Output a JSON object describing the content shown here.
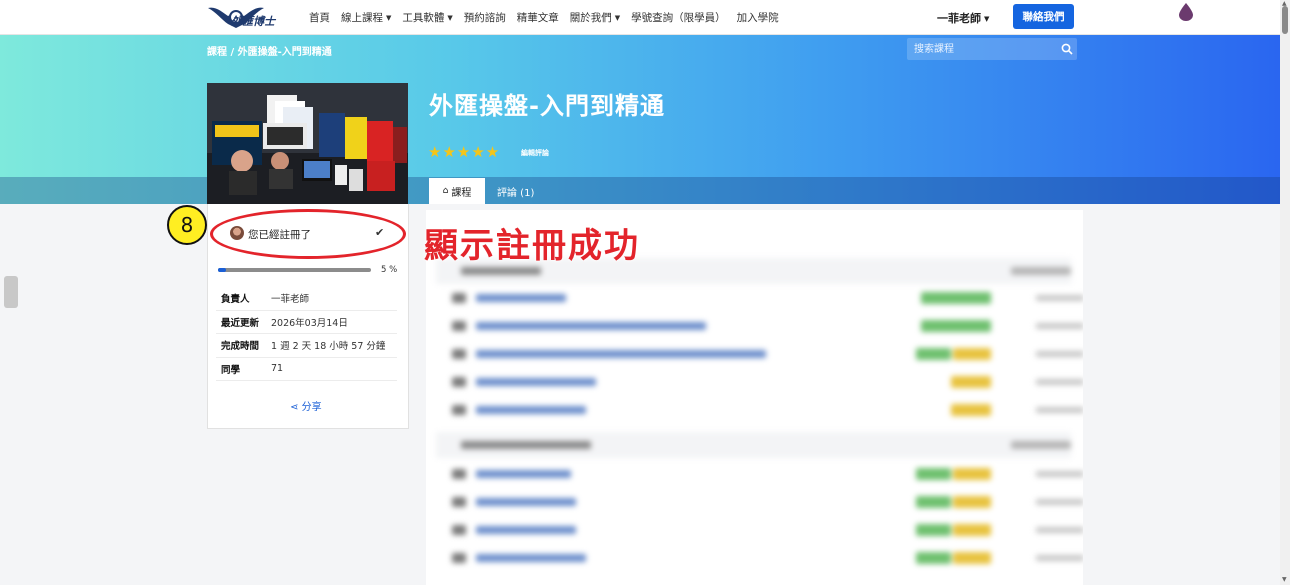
{
  "navbar": {
    "logo_text": "外匯博士",
    "menu": [
      {
        "label": "首頁",
        "dropdown": false
      },
      {
        "label": "線上課程",
        "dropdown": true
      },
      {
        "label": "工具軟體",
        "dropdown": true
      },
      {
        "label": "預約諮詢",
        "dropdown": false
      },
      {
        "label": "精華文章",
        "dropdown": false
      },
      {
        "label": "關於我們",
        "dropdown": true
      },
      {
        "label": "學號查詢（限學員）",
        "dropdown": false
      },
      {
        "label": "加入學院",
        "dropdown": false
      }
    ],
    "user_menu": "一菲老師",
    "contact_button": "聯絡我們"
  },
  "breadcrumb": "課程 / 外匯操盤-入門到精通",
  "search": {
    "placeholder": "搜索課程"
  },
  "course": {
    "title": "外匯操盤-入門到精通",
    "rating_stars": "★★★★★",
    "rating_value": 5,
    "edit_review": "編輯評論"
  },
  "tabs": {
    "course": "課程",
    "reviews": "評論 (1)"
  },
  "sidebar": {
    "enrolled_text": "您已經註冊了",
    "progress_fraction": 0.05,
    "progress_label": "5 %",
    "info": [
      {
        "label": "負責人",
        "value": "一菲老師"
      },
      {
        "label": "最近更新",
        "value": "2026年03月14日"
      },
      {
        "label": "完成時間",
        "value": "1 週 2 天 18 小時 57 分鐘"
      },
      {
        "label": "同學",
        "value": "71"
      }
    ],
    "share": "分享"
  },
  "annotation": {
    "step_number": "8",
    "caption": "顯示註冊成功"
  },
  "colors": {
    "accent_blue": "#1565e0",
    "annotation_red": "#e3242b",
    "star_yellow": "#f5c518"
  }
}
